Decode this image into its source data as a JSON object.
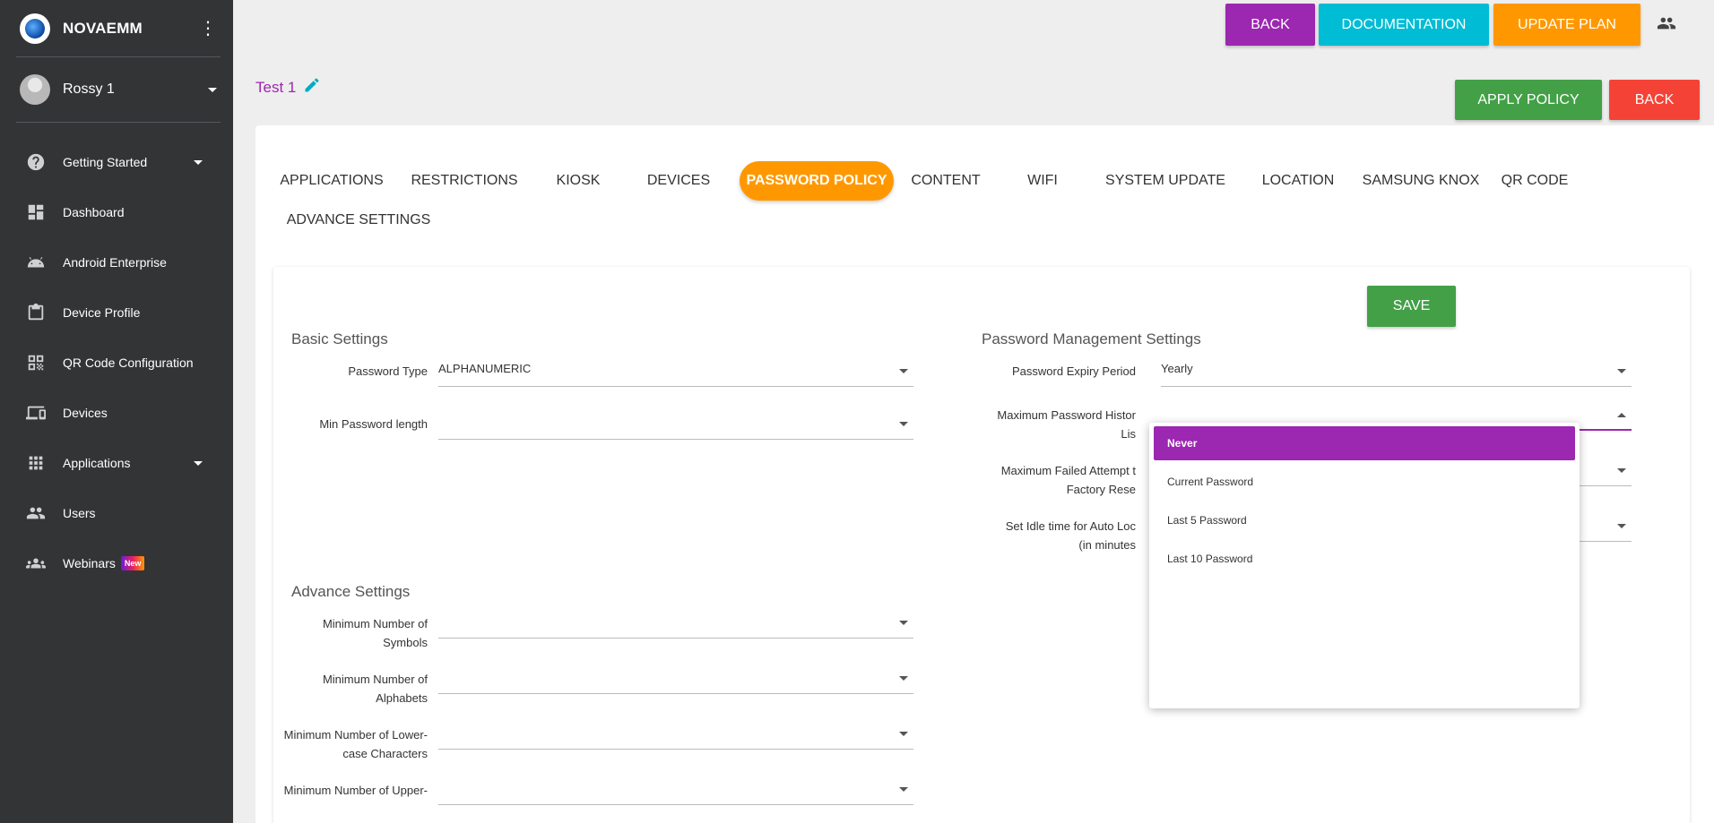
{
  "sidebar": {
    "brand": "NOVAEMM",
    "user_name": "Rossy 1",
    "items": [
      {
        "label": "Getting Started",
        "icon": "help-icon",
        "has_caret": true
      },
      {
        "label": "Dashboard",
        "icon": "dashboard-icon",
        "has_caret": false
      },
      {
        "label": "Android Enterprise",
        "icon": "android-icon",
        "has_caret": false
      },
      {
        "label": "Device Profile",
        "icon": "clipboard-icon",
        "has_caret": false
      },
      {
        "label": "QR Code Configuration",
        "icon": "qr-code-icon",
        "has_caret": false
      },
      {
        "label": "Devices",
        "icon": "devices-icon",
        "has_caret": false
      },
      {
        "label": "Applications",
        "icon": "apps-grid-icon",
        "has_caret": true
      },
      {
        "label": "Users",
        "icon": "users-icon",
        "has_caret": false
      },
      {
        "label": "Webinars",
        "icon": "webinars-icon",
        "has_caret": false,
        "badge": "New"
      }
    ]
  },
  "header": {
    "back_label": "BACK",
    "documentation_label": "DOCUMENTATION",
    "update_plan_label": "UPDATE PLAN"
  },
  "policy": {
    "title": "Test 1",
    "apply_label": "APPLY POLICY",
    "back_label": "BACK"
  },
  "tabs": [
    "APPLICATIONS",
    "RESTRICTIONS",
    "KIOSK",
    "DEVICES",
    "PASSWORD POLICY",
    "CONTENT",
    "WIFI",
    "SYSTEM UPDATE",
    "LOCATION",
    "SAMSUNG KNOX",
    "QR CODE",
    "ADVANCE SETTINGS"
  ],
  "active_tab": "PASSWORD POLICY",
  "form": {
    "save_label": "SAVE",
    "basic": {
      "title": "Basic Settings",
      "password_type_label": "Password Type",
      "password_type_value": "ALPHANUMERIC",
      "min_length_label": "Min Password length",
      "min_length_value": ""
    },
    "advance": {
      "title": "Advance Settings",
      "fields": [
        {
          "label_line1": "Minimum Number of",
          "label_line2": "Symbols",
          "value": ""
        },
        {
          "label_line1": "Minimum Number of",
          "label_line2": "Alphabets",
          "value": ""
        },
        {
          "label_line1": "Minimum Number of Lower-",
          "label_line2": "case Characters",
          "value": ""
        },
        {
          "label_line1": "Minimum Number of Upper-",
          "label_line2": "",
          "value": ""
        }
      ]
    },
    "management": {
      "title": "Password Management Settings",
      "expiry_label": "Password Expiry Period",
      "expiry_value": "Yearly",
      "history_label_line1": "Maximum Password Histor",
      "history_label_line2": "Lis",
      "failed_label_line1": "Maximum Failed Attempt t",
      "failed_label_line2": "Factory Rese",
      "idle_label_line1": "Set Idle time for Auto Loc",
      "idle_label_line2": "(in minutes"
    }
  },
  "dropdown": {
    "options": [
      "Never",
      "Current Password",
      "Last 5 Password",
      "Last 10 Password"
    ],
    "selected": "Never"
  },
  "colors": {
    "sidebar_bg": "#333436",
    "purple": "#9c27b0",
    "cyan": "#00bcd4",
    "orange": "#ff9800",
    "green": "#43a047",
    "red": "#f44336"
  }
}
